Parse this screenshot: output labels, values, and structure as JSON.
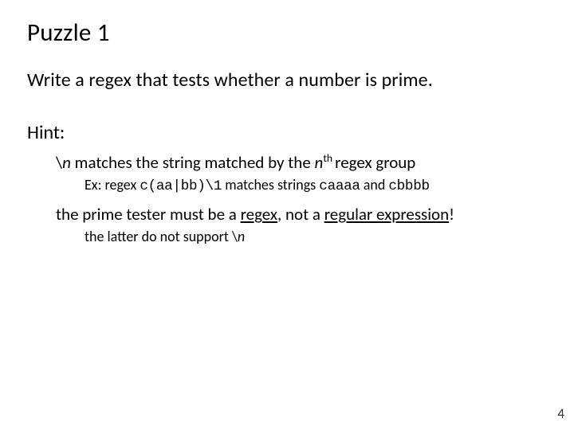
{
  "title": "Puzzle 1",
  "body": "Write a regex that tests whether a number is prime.",
  "hint_label": "Hint:",
  "hint1": {
    "pre": "\\",
    "n": "n",
    "mid": " matches the string matched by the ",
    "nth_n": "n",
    "nth_th": "th ",
    "post": "regex group"
  },
  "ex": {
    "pre": "Ex: regex  ",
    "code1": "c(aa|bb)\\1",
    "mid": "  matches  strings   ",
    "code2": "caaaa",
    "and": "  and  ",
    "code3": "cbbbb"
  },
  "hint2": {
    "pre": "the prime tester must be a ",
    "u1": "regex",
    "mid": ", not a ",
    "u2": "regular expression",
    "post": "!"
  },
  "hint2_sub": {
    "text": "the latter do not support \\",
    "n": "n"
  },
  "page": "4"
}
